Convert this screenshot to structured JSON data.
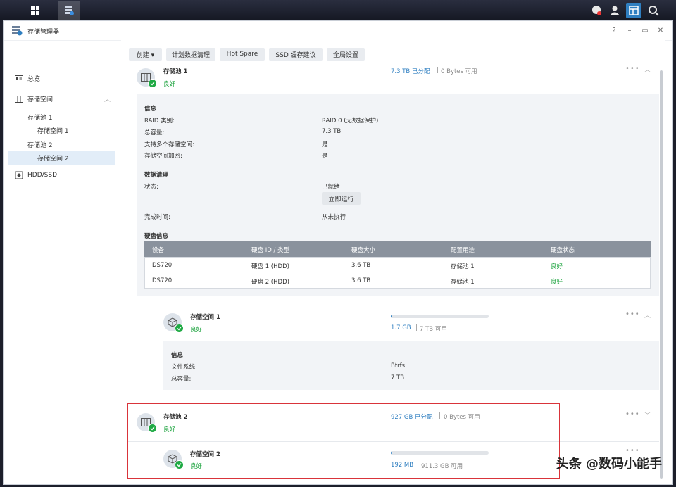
{
  "window": {
    "title": "存储管理器"
  },
  "winctl": {
    "help": "?",
    "minimize": "–",
    "restore": "▭",
    "close": "✕"
  },
  "sidebar": {
    "items": [
      {
        "label": "总览"
      },
      {
        "label": "存储空间"
      },
      {
        "label": "存储池 1"
      },
      {
        "label": "存储空间 1"
      },
      {
        "label": "存储池 2"
      },
      {
        "label": "存储空间 2"
      },
      {
        "label": "HDD/SSD"
      }
    ]
  },
  "toolbar": {
    "create": "创建 ▾",
    "scrub": "计划数据清理",
    "hotspare": "Hot Spare",
    "ssd": "SSD 缓存建议",
    "global": "全局设置"
  },
  "pool1": {
    "name": "存储池 1",
    "status": "良好",
    "allocated": "7.3 TB 已分配",
    "available": "0 Bytes 可用",
    "info_title": "信息",
    "raid_label": "RAID 类别:",
    "raid_value": "RAID 0 (无数据保护)",
    "capacity_label": "总容量:",
    "capacity_value": "7.3 TB",
    "multi_label": "支持多个存储空间:",
    "multi_value": "是",
    "encrypt_label": "存储空间加密:",
    "encrypt_value": "是",
    "scrub_title": "数据清理",
    "state_label": "状态:",
    "state_value": "已就绪",
    "run_button": "立即运行",
    "finish_label": "完成时间:",
    "finish_value": "从未执行",
    "disk_title": "硬盘信息",
    "table": {
      "headers": [
        "设备",
        "硬盘 ID / 类型",
        "硬盘大小",
        "配置用途",
        "硬盘状态"
      ],
      "rows": [
        [
          "DS720",
          "硬盘 1 (HDD)",
          "3.6 TB",
          "存储池 1",
          "良好"
        ],
        [
          "DS720",
          "硬盘 2 (HDD)",
          "3.6 TB",
          "存储池 1",
          "良好"
        ]
      ]
    }
  },
  "volume1": {
    "name": "存储空间 1",
    "status": "良好",
    "used": "1.7 GB",
    "total": "7 TB 可用",
    "usage_fraction": 0.0003,
    "info_title": "信息",
    "fs_label": "文件系统:",
    "fs_value": "Btrfs",
    "capacity_label": "总容量:",
    "capacity_value": "7 TB"
  },
  "pool2": {
    "name": "存储池 2",
    "status": "良好",
    "allocated": "927 GB 已分配",
    "available": "0 Bytes 可用"
  },
  "volume2": {
    "name": "存储空间 2",
    "status": "良好",
    "used": "192 MB",
    "total": "911.3 GB 可用",
    "usage_fraction": 0.0002
  },
  "common": {
    "more": "•••",
    "sep": "|"
  },
  "watermark": "头条 @数码小能手",
  "colors": {
    "accent": "#2f7fc1",
    "ok": "#18a23b",
    "highlight": "#d9343a"
  }
}
